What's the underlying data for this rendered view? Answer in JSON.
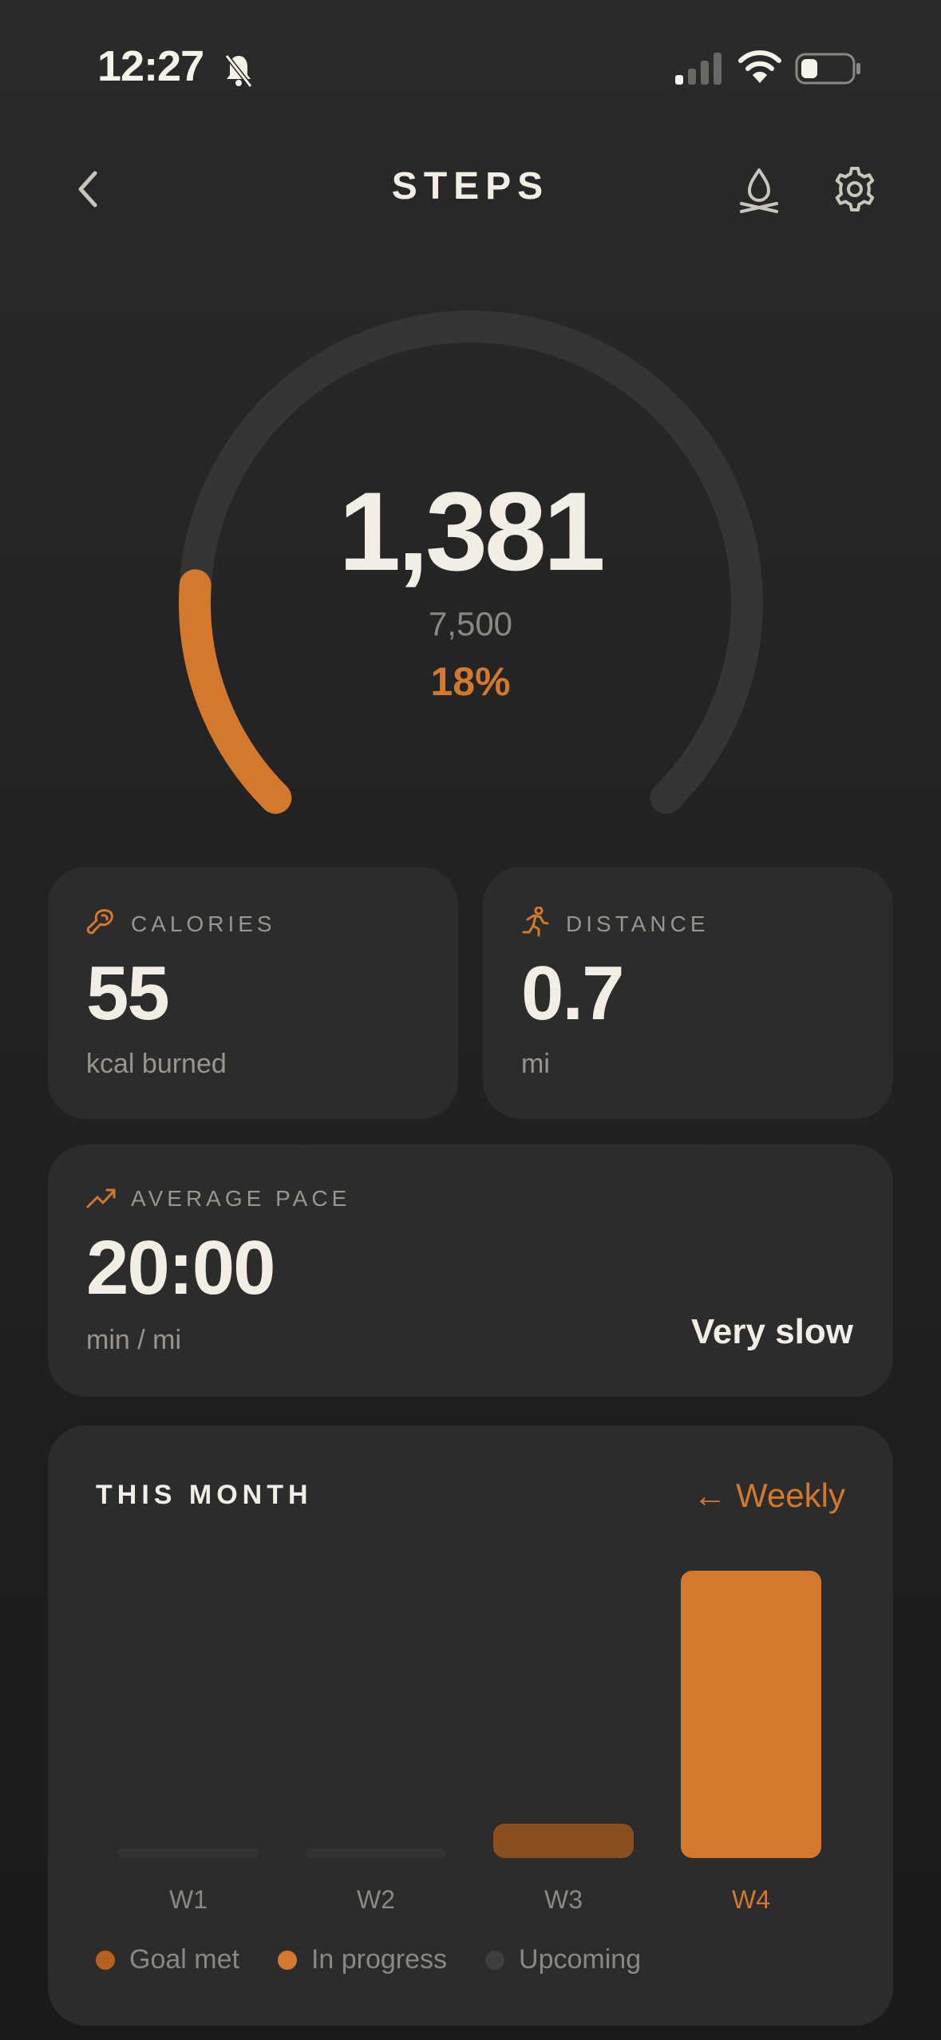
{
  "status_bar": {
    "time": "12:27"
  },
  "header": {
    "title": "STEPS",
    "icons": [
      "back-chevron",
      "campfire",
      "gear"
    ]
  },
  "gauge": {
    "steps": "1,381",
    "goal": "7,500",
    "percent": "18%",
    "progress": 0.18,
    "accent": "#d4782d",
    "track": "#353535"
  },
  "calories": {
    "label": "CALORIES",
    "value": "55",
    "unit": "kcal burned",
    "icon": "drumstick"
  },
  "distance": {
    "label": "DISTANCE",
    "value": "0.7",
    "unit": "mi",
    "icon": "runner"
  },
  "pace": {
    "label": "AVERAGE PACE",
    "value": "20:00",
    "unit": "min / mi",
    "rating": "Very slow",
    "icon": "trend-up"
  },
  "month": {
    "title": "THIS MONTH",
    "toggle": "← Weekly",
    "weeks": [
      {
        "label": "W1",
        "state": "upcoming",
        "level": 0.0
      },
      {
        "label": "W2",
        "state": "upcoming",
        "level": 0.0
      },
      {
        "label": "W3",
        "state": "goal-met",
        "level": 0.12
      },
      {
        "label": "W4",
        "state": "in-progress",
        "level": 1.0
      }
    ],
    "legend": [
      {
        "label": "Goal met",
        "color": "#b8611f"
      },
      {
        "label": "In progress",
        "color": "#d4782d"
      },
      {
        "label": "Upcoming",
        "color": "#3f3f3f"
      }
    ]
  }
}
